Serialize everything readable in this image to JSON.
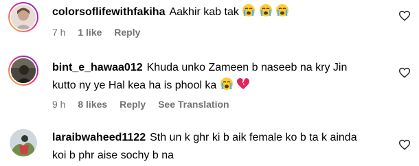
{
  "comments": [
    {
      "username": "colorsoflifewithfakiha",
      "text": "Aakhir kab tak",
      "emojis": [
        "crying-face",
        "crying-face",
        "crying-face"
      ],
      "time": "7 h",
      "likes": "1 like",
      "reply": "Reply",
      "see_translation": ""
    },
    {
      "username": "bint_e_hawaa012",
      "text_line1": "Khuda unko Zameen b naseeb na kry Jin",
      "text_line2": "kutto ny ye Hal kea ha is phool ka",
      "emojis": [
        "crying-face",
        "broken-heart"
      ],
      "time": "9 h",
      "likes": "8 likes",
      "reply": "Reply",
      "see_translation": "See Translation"
    },
    {
      "username": "laraibwaheed1122",
      "text_line1": "Sth un k ghr ki b aik female ko b ta k ainda",
      "text_line2": "koi b phr aise sochy b na"
    }
  ],
  "colors": {
    "meta_gray": "#737373",
    "ring_gradient_start": "#f9ce34",
    "ring_gradient_mid": "#ee2a7b",
    "ring_gradient_end": "#6228d7",
    "broken_heart": "#e0245e"
  }
}
